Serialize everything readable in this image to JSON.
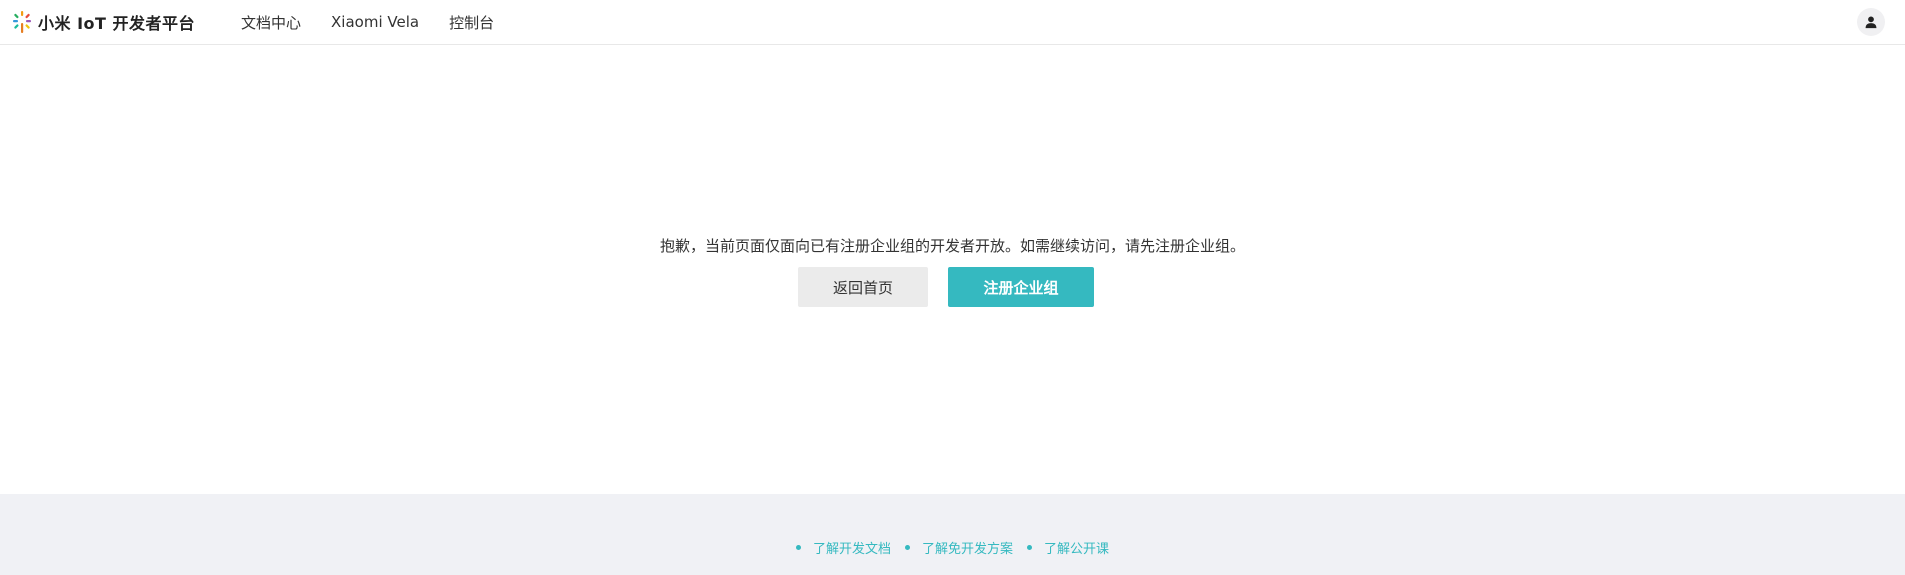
{
  "header": {
    "brand": "小米 IoT 开发者平台",
    "nav": [
      {
        "label": "文档中心"
      },
      {
        "label": "Xiaomi Vela"
      },
      {
        "label": "控制台"
      }
    ],
    "user_icon": "user-icon"
  },
  "main": {
    "message": "抱歉，当前页面仅面向已有注册企业组的开发者开放。如需继续访问，请先注册企业组。",
    "back_button": "返回首页",
    "register_button": "注册企业组"
  },
  "footer": {
    "links": [
      {
        "label": "了解开发文档"
      },
      {
        "label": "了解免开发方案"
      },
      {
        "label": "了解公开课"
      }
    ]
  },
  "colors": {
    "accent": "#35b9c0",
    "footer_bg": "#f0f1f5",
    "secondary_button_bg": "#ebebeb"
  }
}
